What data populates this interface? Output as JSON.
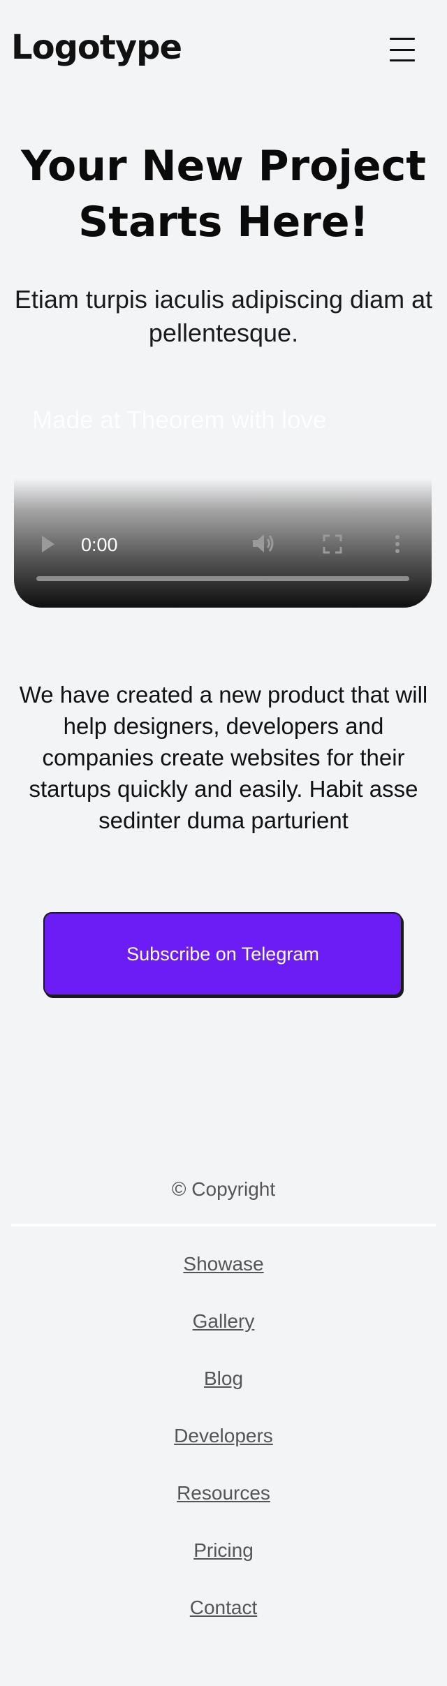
{
  "header": {
    "logo": "Logotype",
    "menu_icon": "hamburger-menu-icon"
  },
  "hero": {
    "title": "Your New Project Starts Here!",
    "subtitle": "Etiam turpis iaculis adipiscing diam at pellentesque."
  },
  "video": {
    "caption": "Made at Theorem with love",
    "time": "0:00",
    "progress": 0,
    "icons": [
      "play-icon",
      "volume-icon",
      "fullscreen-icon",
      "more-vertical-icon"
    ]
  },
  "description": "We have created a new product that will help designers, developers and companies create websites for their startups quickly and easily. Habit asse sedinter duma parturient",
  "cta": {
    "label": "Subscribe on Telegram",
    "color": "#6c1df6"
  },
  "footer": {
    "copyright": "© Copyright",
    "links": [
      "Showase",
      "Gallery",
      "Blog",
      "Developers",
      "Resources",
      "Pricing",
      "Contact"
    ]
  }
}
